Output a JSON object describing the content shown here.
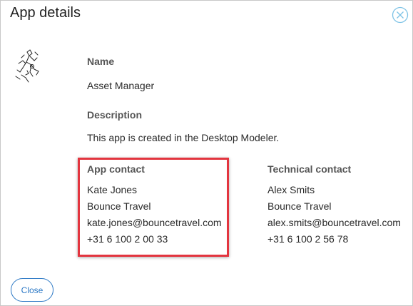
{
  "dialog": {
    "title": "App details",
    "close_icon": "close-circle-icon",
    "app_icon": "app-sketch-icon"
  },
  "name": {
    "label": "Name",
    "value": "Asset Manager"
  },
  "description": {
    "label": "Description",
    "value": "This app is created in the Desktop Modeler."
  },
  "app_contact": {
    "label": "App contact",
    "name": "Kate Jones",
    "company": "Bounce Travel",
    "email": "kate.jones@bouncetravel.com",
    "phone": "+31 6 100 2 00 33"
  },
  "technical_contact": {
    "label": "Technical contact",
    "name": "Alex Smits",
    "company": "Bounce Travel",
    "email": "alex.smits@bouncetravel.com",
    "phone": "+31 6 100 2 56 78"
  },
  "footer": {
    "close_label": "Close"
  },
  "colors": {
    "accent": "#2b78c5",
    "highlight": "#e3353f",
    "close_icon": "#7fc3e6"
  }
}
